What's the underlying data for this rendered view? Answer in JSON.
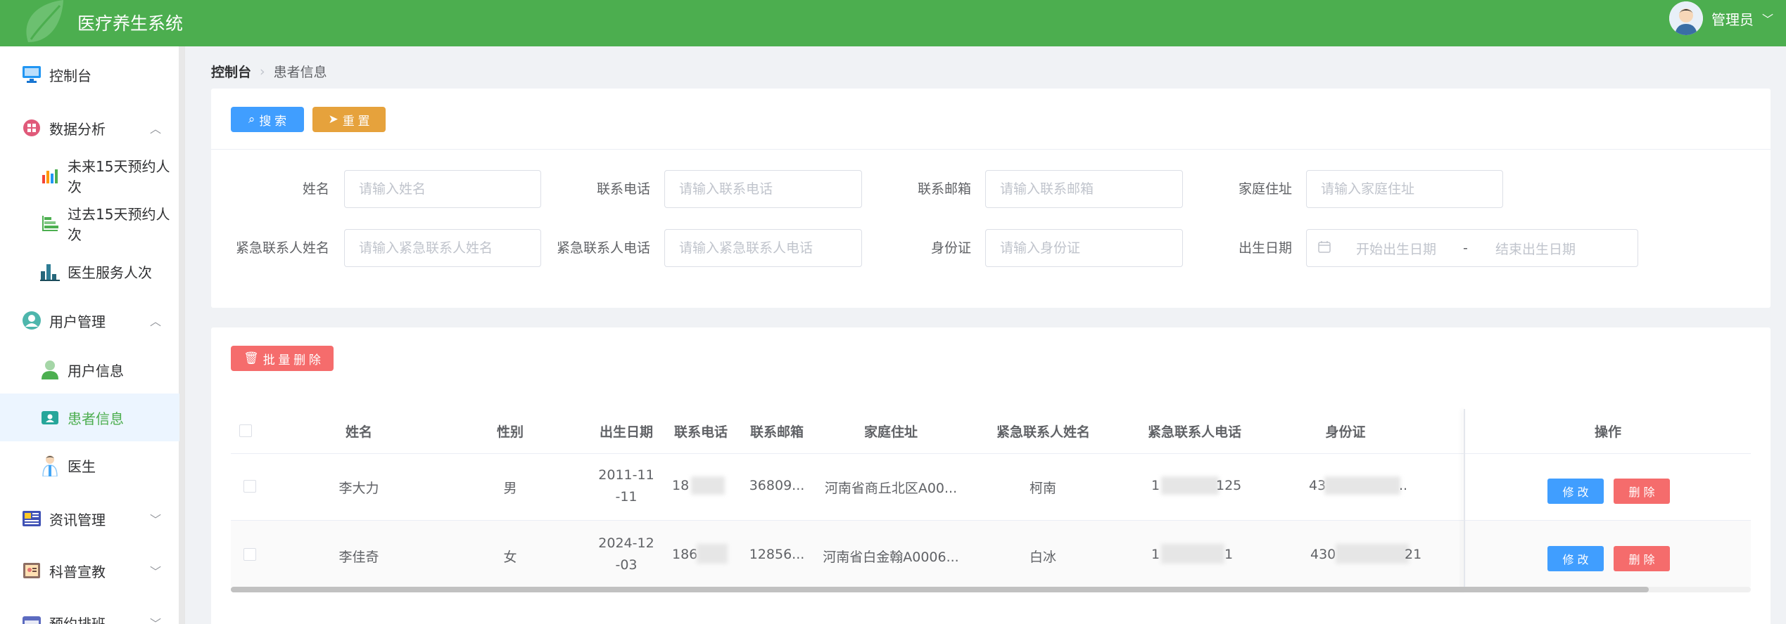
{
  "header": {
    "title": "医疗养生系统",
    "user_name": "管理员",
    "brand_color": "#4cae4f"
  },
  "sidebar": {
    "items": [
      {
        "label": "控制台",
        "icon": "monitor-icon"
      },
      {
        "label": "数据分析",
        "icon": "grid-icon",
        "expanded": true
      },
      {
        "label": "未来15天预约人次",
        "icon": "bar-chart-icon"
      },
      {
        "label": "过去15天预约人次",
        "icon": "horizontal-bar-icon"
      },
      {
        "label": "医生服务人次",
        "icon": "column-chart-icon"
      },
      {
        "label": "用户管理",
        "icon": "user-circle-icon",
        "expanded": true
      },
      {
        "label": "用户信息",
        "icon": "person-icon"
      },
      {
        "label": "患者信息",
        "icon": "id-card-icon",
        "active": true
      },
      {
        "label": "医生",
        "icon": "doctor-icon"
      },
      {
        "label": "资讯管理",
        "icon": "news-icon"
      },
      {
        "label": "科普宣教",
        "icon": "book-icon"
      },
      {
        "label": "预约排班",
        "icon": "calendar-icon"
      }
    ]
  },
  "breadcrumb": {
    "home": "控制台",
    "current": "患者信息"
  },
  "search": {
    "search_btn": "搜 索",
    "reset_btn": "重 置",
    "fields": [
      {
        "label": "姓名",
        "placeholder": "请输入姓名"
      },
      {
        "label": "联系电话",
        "placeholder": "请输入联系电话"
      },
      {
        "label": "联系邮箱",
        "placeholder": "请输入联系邮箱"
      },
      {
        "label": "家庭住址",
        "placeholder": "请输入家庭住址"
      },
      {
        "label": "紧急联系人姓名",
        "placeholder": "请输入紧急联系人姓名"
      },
      {
        "label": "紧急联系人电话",
        "placeholder": "请输入紧急联系人电话"
      },
      {
        "label": "身份证",
        "placeholder": "请输入身份证"
      },
      {
        "label": "出生日期",
        "start": "开始出生日期",
        "sep": "-",
        "end": "结束出生日期"
      }
    ]
  },
  "table": {
    "batch_delete": "批 量 删 除",
    "columns": [
      "姓名",
      "性别",
      "出生日期",
      "联系电话",
      "联系邮箱",
      "家庭住址",
      "紧急联系人姓名",
      "紧急联系人电话",
      "身份证",
      "操作"
    ],
    "rows": [
      {
        "name": "李大力",
        "gender": "男",
        "birth_1": "2011-11",
        "birth_2": "-11",
        "phone": "18",
        "email": "36809...",
        "address": "河南省商丘北区A00...",
        "contact_name": "柯南",
        "contact_phone": "1",
        "contact_phone_tail": "125",
        "id_card": "43",
        "id_card_tail": ".."
      },
      {
        "name": "李佳奇",
        "gender": "女",
        "birth_1": "2024-12",
        "birth_2": "-03",
        "phone": "186",
        "email": "12856...",
        "address": "河南省白金翰A0006...",
        "contact_name": "白冰",
        "contact_phone": "1",
        "contact_phone_tail": "1",
        "id_card": "430",
        "id_card_tail": "21"
      }
    ],
    "edit_btn": "修 改",
    "delete_btn": "删 除"
  }
}
